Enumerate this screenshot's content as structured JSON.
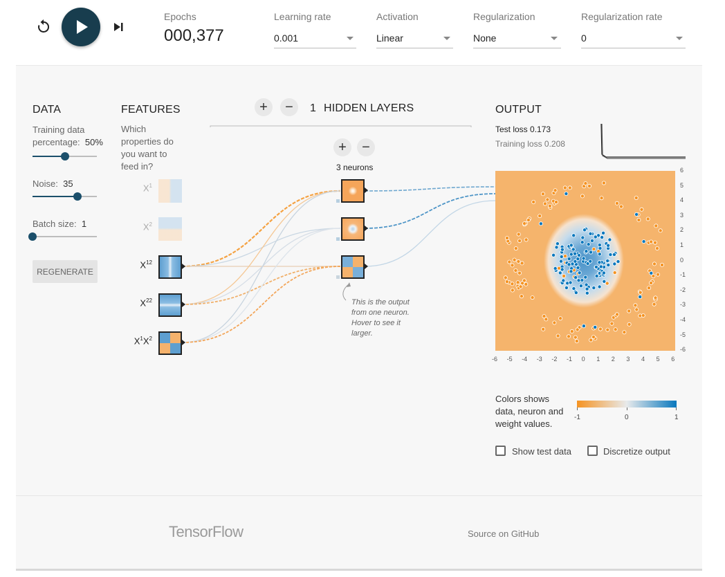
{
  "controls": {
    "epochs_label": "Epochs",
    "epochs_value": "000,377",
    "learning_rate_label": "Learning rate",
    "learning_rate_value": "0.001",
    "activation_label": "Activation",
    "activation_value": "Linear",
    "regularization_label": "Regularization",
    "regularization_value": "None",
    "reg_rate_label": "Regularization rate",
    "reg_rate_value": "0"
  },
  "data_panel": {
    "heading": "DATA",
    "training_pct_label_1": "Training data",
    "training_pct_label_2": "percentage:",
    "training_pct_value": "50%",
    "training_pct": 0.5,
    "noise_label": "Noise:",
    "noise_value": "35",
    "noise": 0.7,
    "batch_label": "Batch size:",
    "batch_value": "1",
    "batch": 0.0,
    "regenerate_label": "REGENERATE"
  },
  "features_panel": {
    "heading": "FEATURES",
    "question": [
      "Which",
      "properties do",
      "you want to",
      "feed in?"
    ],
    "features": [
      {
        "base": "X",
        "sup": "1",
        "sub": "",
        "active": false
      },
      {
        "base": "X",
        "sup": "2",
        "sub": "",
        "active": false
      },
      {
        "base": "X",
        "sup": "1",
        "sub": "2",
        "active": true
      },
      {
        "base": "X",
        "sup": "2",
        "sub": "2",
        "active": true
      },
      {
        "base": "X",
        "sup": "1",
        "sub": "X",
        "active": true
      }
    ],
    "x1x2_label_a": "X",
    "x1x2_label_b": "1",
    "x1x2_label_c": "X",
    "x1x2_label_d": "2"
  },
  "hidden": {
    "add_icon": "+",
    "remove_icon": "−",
    "layer_count": "1",
    "layers_label": "HIDDEN LAYERS",
    "neurons_label": "3 neurons",
    "note": [
      "This is the output",
      "from one neuron.",
      "Hover to see it",
      "larger."
    ]
  },
  "output": {
    "heading": "OUTPUT",
    "test_loss_label": "Test loss 0.173",
    "training_loss_label": "Training loss 0.208",
    "x_ticks": [
      "-6",
      "-5",
      "-4",
      "-3",
      "-2",
      "-1",
      "0",
      "1",
      "2",
      "3",
      "4",
      "5",
      "6"
    ],
    "y_ticks": [
      "6",
      "5",
      "4",
      "3",
      "2",
      "1",
      "0",
      "-1",
      "-2",
      "-3",
      "-4",
      "-5",
      "-6"
    ],
    "legend_text": [
      "Colors shows",
      "data, neuron and",
      "weight values."
    ],
    "legend_min": "-1",
    "legend_mid": "0",
    "legend_max": "1",
    "show_test_label": "Show test data",
    "discretize_label": "Discretize output"
  },
  "footer": {
    "brand": "TensorFlow",
    "source_link": "Source on GitHub"
  },
  "colors": {
    "orange": "#f59322",
    "blue": "#0877bd",
    "play_bg": "#183d4e",
    "panel_bg": "#f7f7f7"
  }
}
